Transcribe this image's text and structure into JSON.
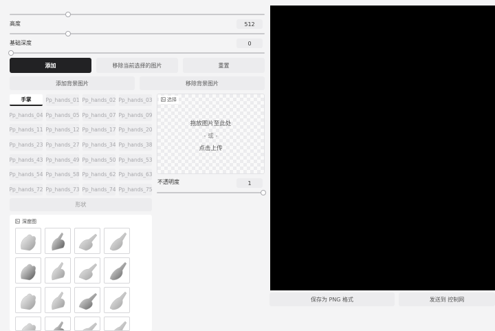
{
  "controls": {
    "height_label": "高度",
    "height_value": "512",
    "depth_label": "基础深度",
    "depth_value": "0",
    "opacity_label": "不透明度",
    "opacity_value": "1"
  },
  "buttons": {
    "add": "添加",
    "remove_selected": "移除当前选择的图片",
    "reset": "重置",
    "add_background": "添加背景图片",
    "remove_background": "移除背景图片",
    "shape": "形状",
    "save_png": "保存为 PNG 格式",
    "send_to_controlnet": "发送到 控制网"
  },
  "tabs": {
    "active": "手掌",
    "items": [
      "Pp_hands_01",
      "Pp_hands_02",
      "Pp_hands_03",
      "Pp_hands_04",
      "Pp_hands_05",
      "Pp_hands_07",
      "Pp_hands_09",
      "Pp_hands_11",
      "Pp_hands_12",
      "Pp_hands_17",
      "Pp_hands_20",
      "Pp_hands_23",
      "Pp_hands_27",
      "Pp_hands_34",
      "Pp_hands_38",
      "Pp_hands_43",
      "Pp_hands_49",
      "Pp_hands_50",
      "Pp_hands_53",
      "Pp_hands_54",
      "Pp_hands_58",
      "Pp_hands_62",
      "Pp_hands_63",
      "Pp_hands_72",
      "Pp_hands_73",
      "Pp_hands_74",
      "Pp_hands_75"
    ]
  },
  "upload": {
    "tag": "选择",
    "drop": "拖放图片至此处",
    "or": "- 或 -",
    "click": "点击上传"
  },
  "gallery": {
    "title": "深度图"
  },
  "icons": {
    "gallery_icon": "image-icon",
    "upload_icon": "image-icon"
  }
}
